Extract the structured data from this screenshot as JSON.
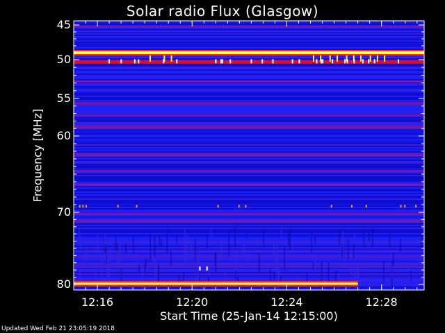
{
  "chart_data": {
    "type": "heatmap",
    "title": "Solar radio Flux (Glasgow)",
    "xlabel": "Start Time (25-Jan-14 12:15:00)",
    "ylabel": "Frequency [MHz]",
    "x_ticks": [
      "12:16",
      "12:20",
      "12:24",
      "12:28"
    ],
    "x_tick_minutes": [
      1,
      5,
      9,
      13
    ],
    "x_range_minutes": [
      0.0,
      14.8
    ],
    "y_ticks": [
      45,
      50,
      55,
      60,
      70,
      80
    ],
    "ylim": [
      44.3,
      80.4
    ],
    "colormap": [
      "#0000ff",
      "#ff0000",
      "#ffff00",
      "#ffffff"
    ],
    "grid": false,
    "features": {
      "bright_bands_mhz": [
        49.0,
        50.3
      ],
      "strong_band_mhz": 79.9,
      "strong_band_end_minute": 12.0,
      "weak_bands_mhz": [
        45.2,
        52.8,
        55.6,
        57.3,
        58.9,
        62.5,
        64.6,
        66.4,
        70.2,
        71.3
      ],
      "burst_minutes": [
        3.2,
        3.8,
        4.1,
        10.1,
        10.4,
        10.8,
        11.1,
        11.5,
        11.8,
        12.1,
        12.5,
        12.8,
        13.1
      ]
    }
  },
  "footer": {
    "updated": "Updated Wed Feb 21 23:05:19 2018"
  }
}
